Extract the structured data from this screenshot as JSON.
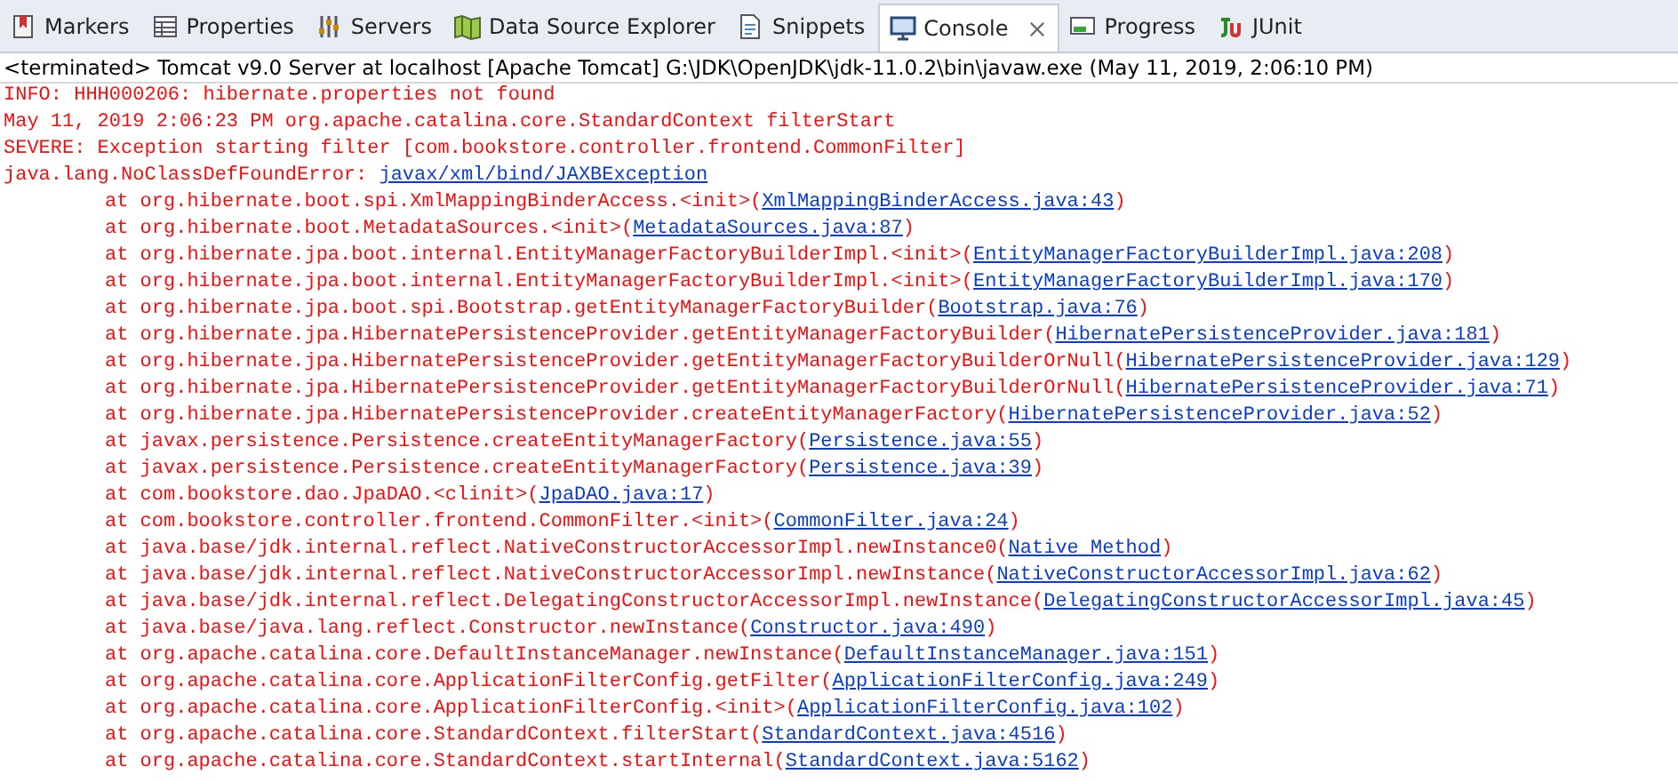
{
  "tabs": [
    {
      "label": "Markers",
      "selected": false
    },
    {
      "label": "Properties",
      "selected": false
    },
    {
      "label": "Servers",
      "selected": false
    },
    {
      "label": "Data Source Explorer",
      "selected": false
    },
    {
      "label": "Snippets",
      "selected": false
    },
    {
      "label": "Console",
      "selected": true,
      "closable": true
    },
    {
      "label": "Progress",
      "selected": false
    },
    {
      "label": "JUnit",
      "selected": false
    }
  ],
  "console": {
    "header": "<terminated> Tomcat v9.0 Server at localhost [Apache Tomcat] G:\\JDK\\OpenJDK\\jdk-11.0.2\\bin\\javaw.exe (May 11, 2019, 2:06:10 PM)",
    "lines": [
      {
        "kind": "message",
        "text": "INFO: HHH000206: hibernate.properties not found"
      },
      {
        "kind": "message",
        "text": "May 11, 2019 2:06:23 PM org.apache.catalina.core.StandardContext filterStart"
      },
      {
        "kind": "message",
        "text": "SEVERE: Exception starting filter [com.bookstore.controller.frontend.CommonFilter]"
      },
      {
        "kind": "message",
        "text": "java.lang.NoClassDefFoundError: ",
        "link": "javax/xml/bind/JAXBException"
      },
      {
        "kind": "frame",
        "text": "at org.hibernate.boot.spi.XmlMappingBinderAccess.<init>(",
        "link": "XmlMappingBinderAccess.java:43",
        "after": ")"
      },
      {
        "kind": "frame",
        "text": "at org.hibernate.boot.MetadataSources.<init>(",
        "link": "MetadataSources.java:87",
        "after": ")"
      },
      {
        "kind": "frame",
        "text": "at org.hibernate.jpa.boot.internal.EntityManagerFactoryBuilderImpl.<init>(",
        "link": "EntityManagerFactoryBuilderImpl.java:208",
        "after": ")"
      },
      {
        "kind": "frame",
        "text": "at org.hibernate.jpa.boot.internal.EntityManagerFactoryBuilderImpl.<init>(",
        "link": "EntityManagerFactoryBuilderImpl.java:170",
        "after": ")"
      },
      {
        "kind": "frame",
        "text": "at org.hibernate.jpa.boot.spi.Bootstrap.getEntityManagerFactoryBuilder(",
        "link": "Bootstrap.java:76",
        "after": ")"
      },
      {
        "kind": "frame",
        "text": "at org.hibernate.jpa.HibernatePersistenceProvider.getEntityManagerFactoryBuilder(",
        "link": "HibernatePersistenceProvider.java:181",
        "after": ")"
      },
      {
        "kind": "frame",
        "text": "at org.hibernate.jpa.HibernatePersistenceProvider.getEntityManagerFactoryBuilderOrNull(",
        "link": "HibernatePersistenceProvider.java:129",
        "after": ")"
      },
      {
        "kind": "frame",
        "text": "at org.hibernate.jpa.HibernatePersistenceProvider.getEntityManagerFactoryBuilderOrNull(",
        "link": "HibernatePersistenceProvider.java:71",
        "after": ")"
      },
      {
        "kind": "frame",
        "text": "at org.hibernate.jpa.HibernatePersistenceProvider.createEntityManagerFactory(",
        "link": "HibernatePersistenceProvider.java:52",
        "after": ")"
      },
      {
        "kind": "frame",
        "text": "at javax.persistence.Persistence.createEntityManagerFactory(",
        "link": "Persistence.java:55",
        "after": ")"
      },
      {
        "kind": "frame",
        "text": "at javax.persistence.Persistence.createEntityManagerFactory(",
        "link": "Persistence.java:39",
        "after": ")"
      },
      {
        "kind": "frame",
        "text": "at com.bookstore.dao.JpaDAO.<clinit>(",
        "link": "JpaDAO.java:17",
        "after": ")"
      },
      {
        "kind": "frame",
        "text": "at com.bookstore.controller.frontend.CommonFilter.<init>(",
        "link": "CommonFilter.java:24",
        "after": ")"
      },
      {
        "kind": "frame",
        "text": "at java.base/jdk.internal.reflect.NativeConstructorAccessorImpl.newInstance0(",
        "link": "Native Method",
        "after": ")"
      },
      {
        "kind": "frame",
        "text": "at java.base/jdk.internal.reflect.NativeConstructorAccessorImpl.newInstance(",
        "link": "NativeConstructorAccessorImpl.java:62",
        "after": ")"
      },
      {
        "kind": "frame",
        "text": "at java.base/jdk.internal.reflect.DelegatingConstructorAccessorImpl.newInstance(",
        "link": "DelegatingConstructorAccessorImpl.java:45",
        "after": ")"
      },
      {
        "kind": "frame",
        "text": "at java.base/java.lang.reflect.Constructor.newInstance(",
        "link": "Constructor.java:490",
        "after": ")"
      },
      {
        "kind": "frame",
        "text": "at org.apache.catalina.core.DefaultInstanceManager.newInstance(",
        "link": "DefaultInstanceManager.java:151",
        "after": ")"
      },
      {
        "kind": "frame",
        "text": "at org.apache.catalina.core.ApplicationFilterConfig.getFilter(",
        "link": "ApplicationFilterConfig.java:249",
        "after": ")"
      },
      {
        "kind": "frame",
        "text": "at org.apache.catalina.core.ApplicationFilterConfig.<init>(",
        "link": "ApplicationFilterConfig.java:102",
        "after": ")"
      },
      {
        "kind": "frame",
        "text": "at org.apache.catalina.core.StandardContext.filterStart(",
        "link": "StandardContext.java:4516",
        "after": ")"
      },
      {
        "kind": "frame",
        "text": "at org.apache.catalina.core.StandardContext.startInternal(",
        "link": "StandardContext.java:5162",
        "after": ")"
      }
    ]
  }
}
